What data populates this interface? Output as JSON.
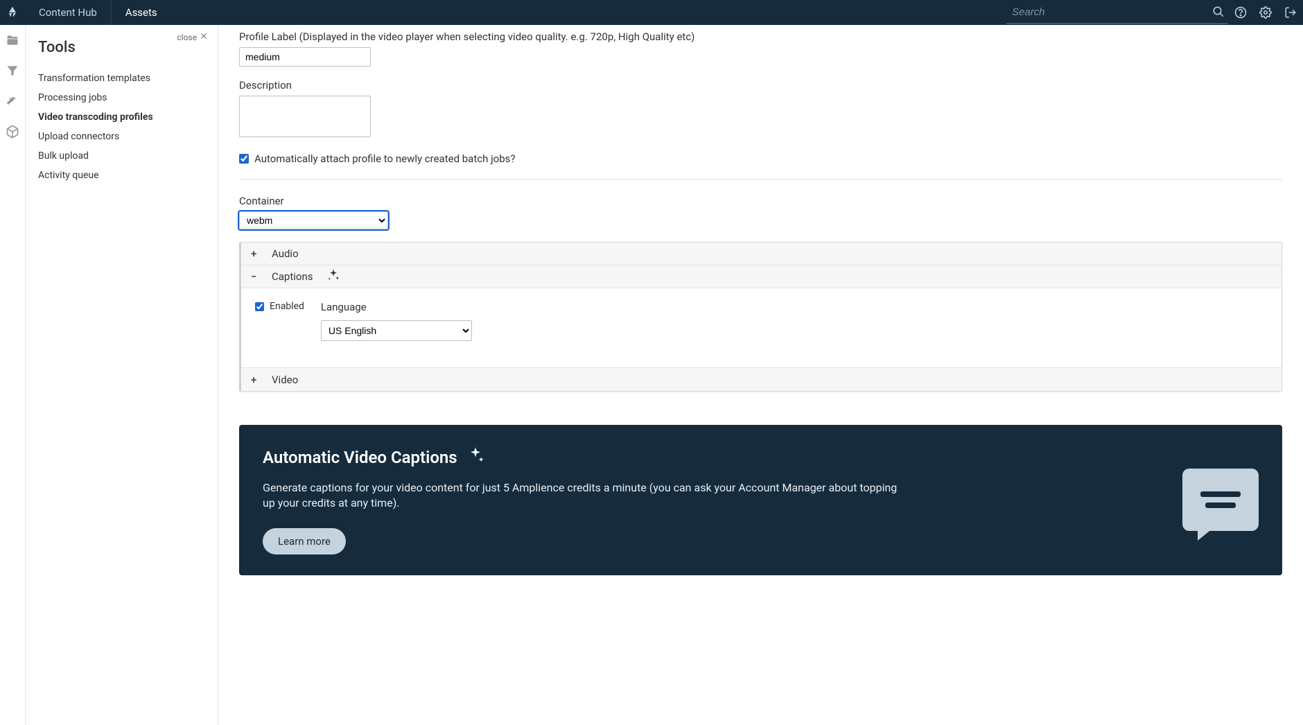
{
  "topbar": {
    "brand": "Content Hub",
    "tab_assets": "Assets",
    "search_placeholder": "Search"
  },
  "sidepanel": {
    "close_label": "close",
    "title": "Tools",
    "items": [
      "Transformation templates",
      "Processing jobs",
      "Video transcoding profiles",
      "Upload connectors",
      "Bulk upload",
      "Activity queue"
    ],
    "active_index": 2
  },
  "form": {
    "profile_label_label": "Profile Label (Displayed in the video player when selecting video quality. e.g. 720p, High Quality etc)",
    "profile_label_value": "medium",
    "description_label": "Description",
    "description_value": "",
    "auto_attach_label": "Automatically attach profile to newly created batch jobs?",
    "auto_attach_checked": true,
    "container_label": "Container",
    "container_value": "webm"
  },
  "accordion": {
    "audio_label": "Audio",
    "captions_label": "Captions",
    "video_label": "Video",
    "captions_enabled_label": "Enabled",
    "captions_enabled_checked": true,
    "language_label": "Language",
    "language_value": "US English"
  },
  "promo": {
    "title": "Automatic Video Captions",
    "body": "Generate captions for your video content for just 5 Amplience credits a minute (you can ask your Account Manager about topping up your credits at any time).",
    "cta": "Learn more"
  }
}
